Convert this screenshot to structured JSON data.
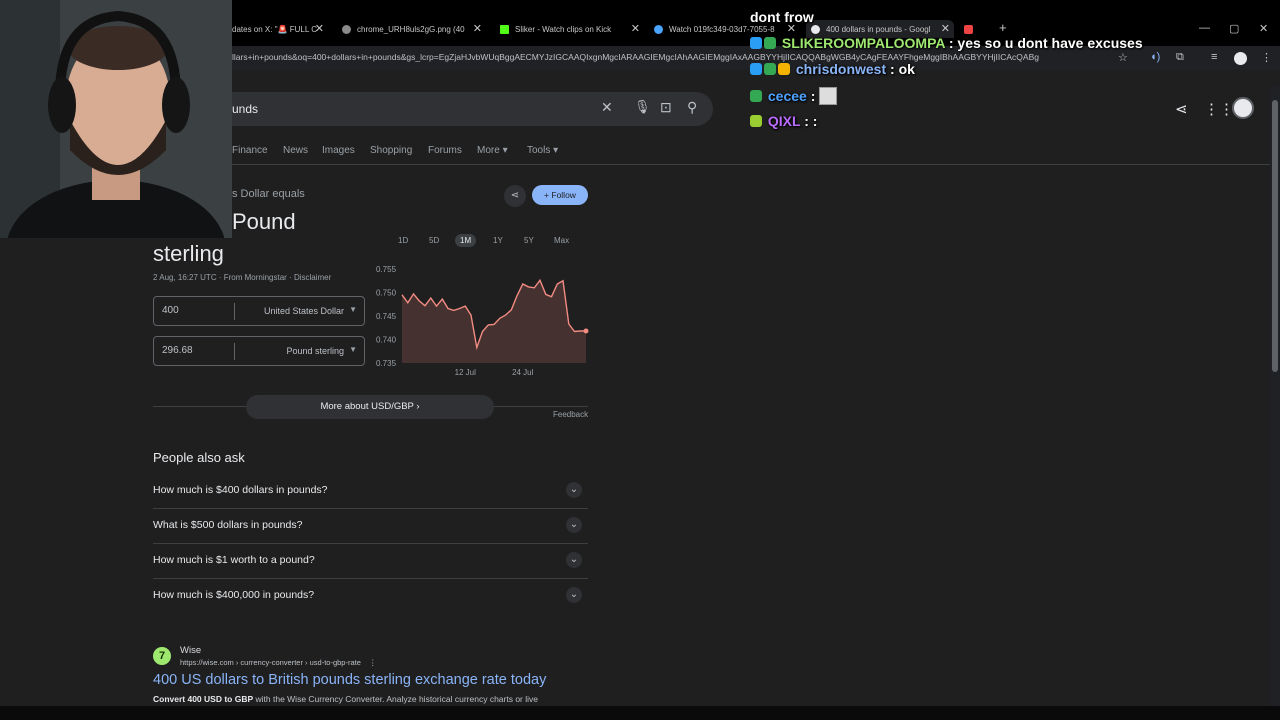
{
  "tabs": [
    {
      "label": "dates on X: \"🚨 FULL C",
      "active": false
    },
    {
      "label": "chrome_URH8uls2gG.png (40",
      "active": false
    },
    {
      "label": "Sliker - Watch clips on Kick",
      "active": false
    },
    {
      "label": "Watch 019fc349-03d7-7055-8",
      "active": false
    },
    {
      "label": "400 dollars in pounds - Googl",
      "active": true
    }
  ],
  "address_bar": {
    "url": "llars+in+pounds&oq=400+dollars+in+pounds&gs_lcrp=EgZjaHJvbWUqBggAECMYJzIGCAAQIxgnMgcIARAAGIEMgcIAhAAGIEMggIAxAAGBYYHjIICAQQABgWGB4yCAgFEAAYFhgeMggIBhAAGBYYHjIICAcQABg"
  },
  "search": {
    "query_visible": "unds"
  },
  "nav_tabs": [
    "Finance",
    "News",
    "Images",
    "Shopping",
    "Forums",
    "More",
    "Tools"
  ],
  "finance": {
    "subtitle": "s Dollar equals",
    "title_line1": "Pound",
    "title_line2": "sterling",
    "meta": "2 Aug, 16:27 UTC · From Morningstar · Disclaimer",
    "follow_label": "Follow",
    "ranges": [
      "1D",
      "5D",
      "1M",
      "1Y",
      "5Y",
      "Max"
    ],
    "active_range": "1M",
    "from_amount": "400",
    "from_currency": "United States Dollar",
    "to_amount": "296.68",
    "to_currency": "Pound sterling",
    "more_label": "More about USD/GBP",
    "feedback_label": "Feedback"
  },
  "chart_data": {
    "type": "line",
    "title": "",
    "xlabel": "",
    "ylabel": "",
    "ylim": [
      0.735,
      0.755
    ],
    "y_ticks": [
      "0.755",
      "0.750",
      "0.745",
      "0.740",
      "0.735"
    ],
    "x_tick_labels": [
      "12 Jul",
      "24 Jul"
    ],
    "series": [
      {
        "values": [
          0.7495,
          0.7478,
          0.7497,
          0.7482,
          0.7472,
          0.7488,
          0.7471,
          0.7486,
          0.7466,
          0.7462,
          0.7466,
          0.7471,
          0.7452,
          0.7383,
          0.7417,
          0.7431,
          0.7432,
          0.7445,
          0.7452,
          0.7463,
          0.7493,
          0.7518,
          0.7512,
          0.751,
          0.7526,
          0.7496,
          0.7491,
          0.7518,
          0.7525,
          0.7433,
          0.7417,
          0.7418,
          0.7418
        ]
      }
    ],
    "color": "#f28b82"
  },
  "people_also_ask": {
    "title": "People also ask",
    "questions": [
      "How much is $400 dollars in pounds?",
      "What is $500 dollars in pounds?",
      "How much is $1 worth to a pound?",
      "How much is $400,000 in pounds?"
    ]
  },
  "result": {
    "site_name": "Wise",
    "breadcrumb": "https://wise.com › currency-converter › usd-to-gbp-rate",
    "title": "400 US dollars to British pounds sterling exchange rate today",
    "snippet_bold": "Convert 400 USD to GBP",
    "snippet_rest": " with the Wise Currency Converter. Analyze historical currency charts or live"
  },
  "chat": [
    {
      "user": "",
      "text": "dont frow",
      "user_color": "#ffffff"
    },
    {
      "user": "SLIKEROOMPALOOMPA",
      "text": " : yes so u dont have excuses",
      "user_color": "#9fe870"
    },
    {
      "user": "chrisdonwest",
      "text": " : ok",
      "user_color": "#8ab4f8"
    },
    {
      "user": "cecee",
      "text": " : ",
      "user_color": "#4fa3ff"
    },
    {
      "user": "QIXL",
      "text": " : :",
      "user_color": "#b96cff"
    }
  ]
}
